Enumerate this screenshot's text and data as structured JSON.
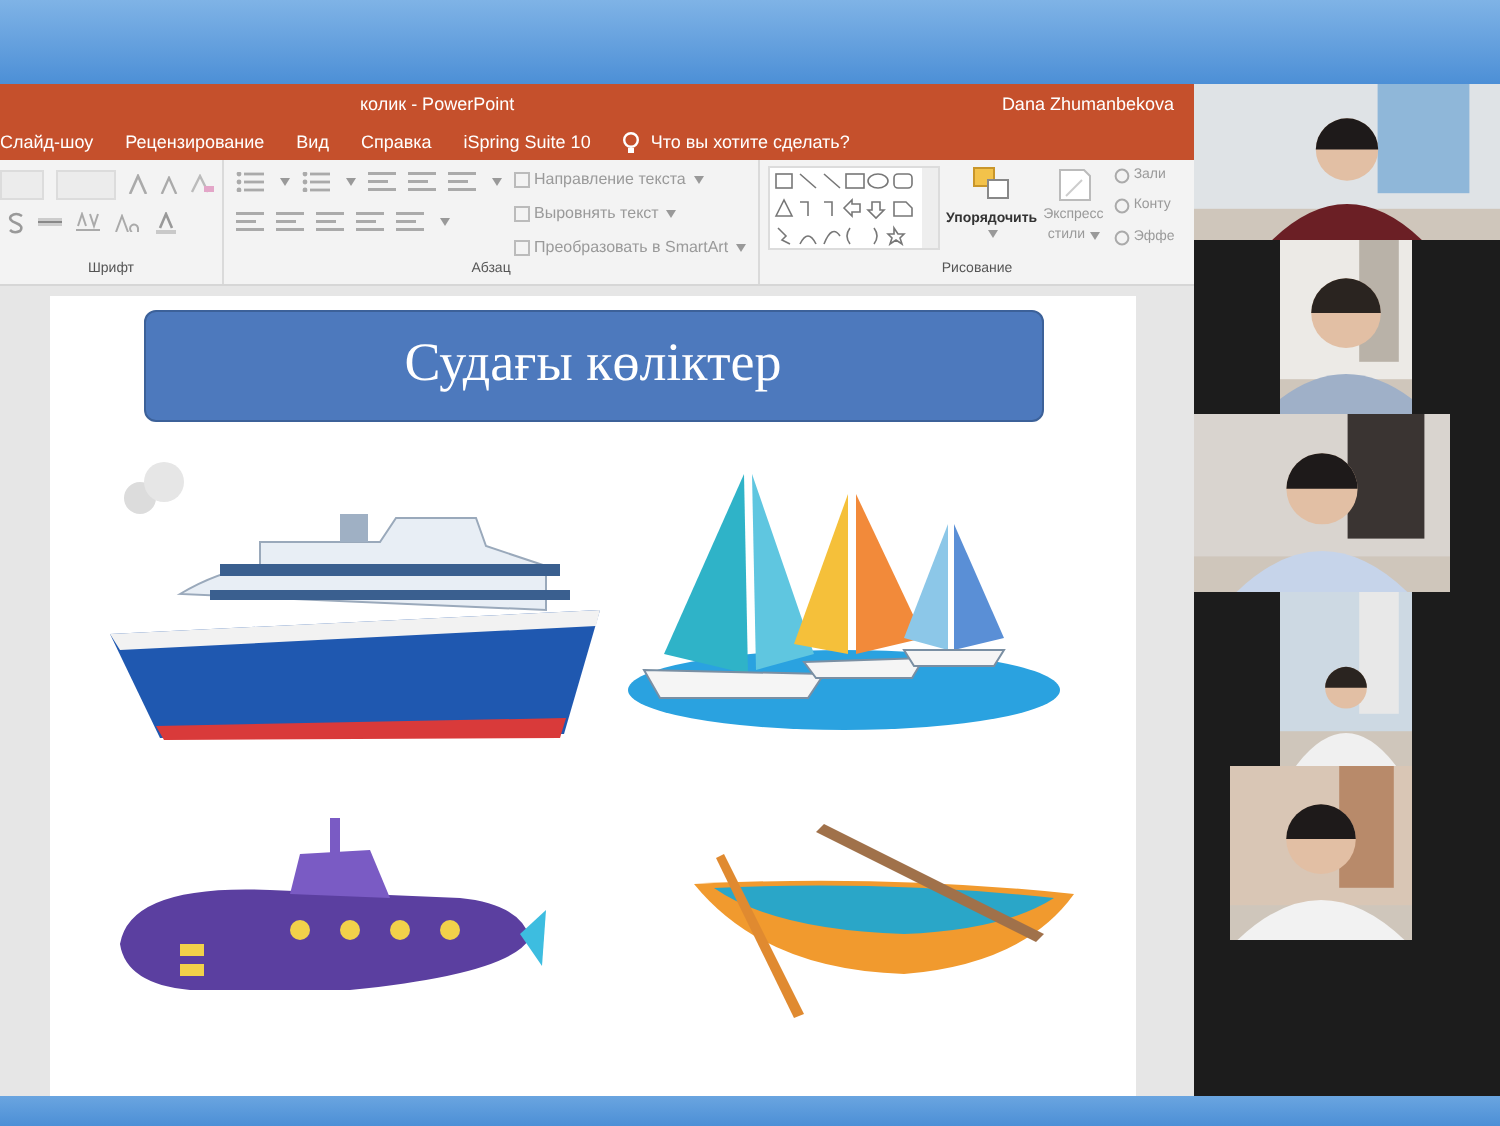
{
  "window": {
    "title": "колик - PowerPoint",
    "user": "Dana Zhumanbekova"
  },
  "ribbon_tabs": [
    {
      "label": "Слайд-шоу",
      "selected": false
    },
    {
      "label": "Рецензирование",
      "selected": false
    },
    {
      "label": "Вид",
      "selected": false
    },
    {
      "label": "Справка",
      "selected": false
    },
    {
      "label": "iSpring Suite 10",
      "selected": false
    }
  ],
  "tell_me": {
    "placeholder": "Что вы хотите сделать?"
  },
  "ribbon": {
    "font_group": {
      "label": "Шрифт"
    },
    "paragraph_group": {
      "label": "Абзац",
      "commands": [
        "Направление текста",
        "Выровнять текст",
        "Преобразовать в SmartArt"
      ]
    },
    "drawing_group": {
      "label": "Рисование",
      "arrange": "Упорядочить",
      "quick_styles": [
        "Экспресс",
        "стили"
      ],
      "commands": [
        "Зали",
        "Конту",
        "Эффе"
      ]
    }
  },
  "slide": {
    "title": "Судағы көліктер"
  }
}
